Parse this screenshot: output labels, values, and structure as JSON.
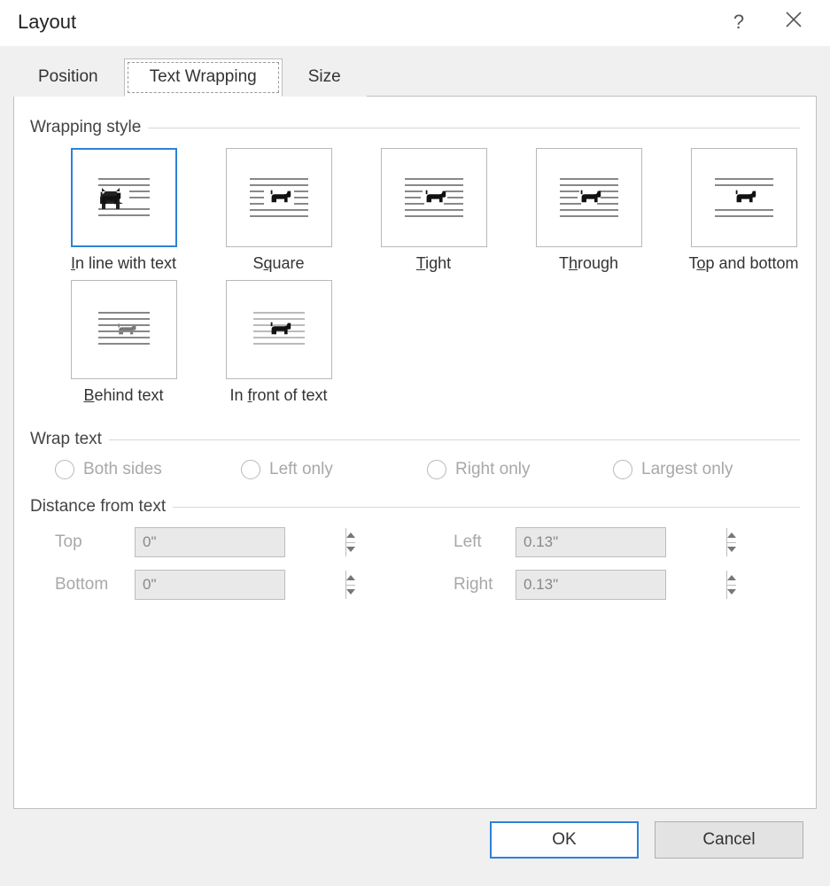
{
  "dialog": {
    "title": "Layout"
  },
  "tabs": {
    "position": "Position",
    "text_wrapping": "Text Wrapping",
    "size": "Size",
    "active": "text_wrapping"
  },
  "groups": {
    "wrapping_style": "Wrapping style",
    "wrap_text": "Wrap text",
    "distance_from_text": "Distance from text"
  },
  "styles": {
    "inline": {
      "label": "In line with text",
      "selected": true
    },
    "square": {
      "label": "Square"
    },
    "tight": {
      "label": "Tight"
    },
    "through": {
      "label": "Through"
    },
    "topbot": {
      "label": "Top and bottom"
    },
    "behind": {
      "label": "Behind text"
    },
    "front": {
      "label": "In front of text"
    }
  },
  "wrap_text_options": {
    "both": {
      "label": "Both sides",
      "enabled": false
    },
    "left": {
      "label": "Left only",
      "enabled": false
    },
    "right": {
      "label": "Right only",
      "enabled": false
    },
    "largest": {
      "label": "Largest only",
      "enabled": false
    }
  },
  "distance": {
    "top_label": "Top",
    "top_value": "0\"",
    "bottom_label": "Bottom",
    "bottom_value": "0\"",
    "left_label": "Left",
    "left_value": "0.13\"",
    "right_label": "Right",
    "right_value": "0.13\"",
    "enabled": false
  },
  "buttons": {
    "ok": "OK",
    "cancel": "Cancel"
  }
}
